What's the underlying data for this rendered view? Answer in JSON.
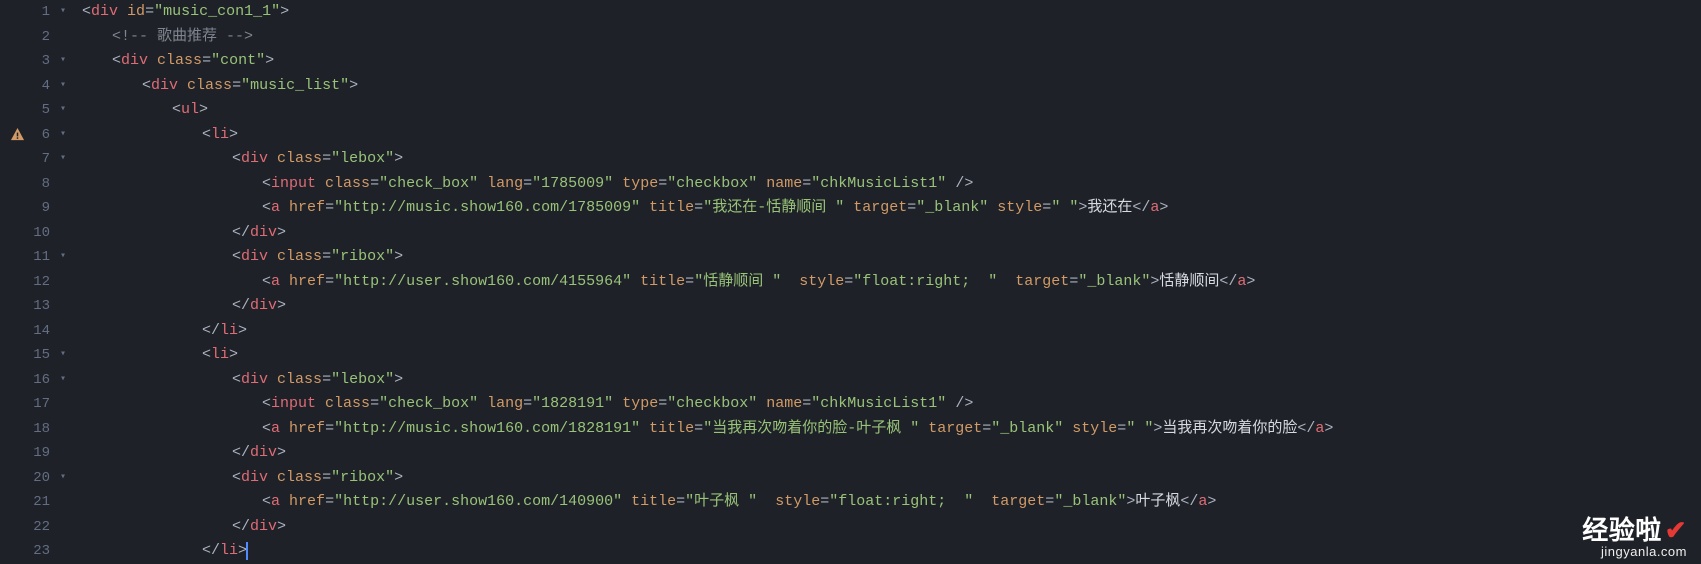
{
  "watermark": {
    "brand": "经验啦",
    "url": "jingyanla.com"
  },
  "gutter": [
    {
      "n": "1",
      "fold": true,
      "warn": false
    },
    {
      "n": "2",
      "fold": false,
      "warn": false
    },
    {
      "n": "3",
      "fold": true,
      "warn": false
    },
    {
      "n": "4",
      "fold": true,
      "warn": false
    },
    {
      "n": "5",
      "fold": true,
      "warn": false
    },
    {
      "n": "6",
      "fold": true,
      "warn": true
    },
    {
      "n": "7",
      "fold": true,
      "warn": false
    },
    {
      "n": "8",
      "fold": false,
      "warn": false
    },
    {
      "n": "9",
      "fold": false,
      "warn": false
    },
    {
      "n": "10",
      "fold": false,
      "warn": false
    },
    {
      "n": "11",
      "fold": true,
      "warn": false
    },
    {
      "n": "12",
      "fold": false,
      "warn": false
    },
    {
      "n": "13",
      "fold": false,
      "warn": false
    },
    {
      "n": "14",
      "fold": false,
      "warn": false
    },
    {
      "n": "15",
      "fold": true,
      "warn": false
    },
    {
      "n": "16",
      "fold": true,
      "warn": false
    },
    {
      "n": "17",
      "fold": false,
      "warn": false
    },
    {
      "n": "18",
      "fold": false,
      "warn": false
    },
    {
      "n": "19",
      "fold": false,
      "warn": false
    },
    {
      "n": "20",
      "fold": true,
      "warn": false
    },
    {
      "n": "21",
      "fold": false,
      "warn": false
    },
    {
      "n": "22",
      "fold": false,
      "warn": false
    },
    {
      "n": "23",
      "fold": false,
      "warn": false
    }
  ],
  "code": {
    "l1": {
      "open": "<",
      "tag": "div",
      "a_id": "id",
      "v_id": "\"music_con1_1\"",
      "close": ">"
    },
    "l2": {
      "open": "<!-- ",
      "text": "歌曲推荐",
      "close": " -->"
    },
    "l3": {
      "open": "<",
      "tag": "div",
      "a_cls": "class",
      "v_cls": "\"cont\"",
      "close": ">"
    },
    "l4": {
      "open": "<",
      "tag": "div",
      "a_cls": "class",
      "v_cls": "\"music_list\"",
      "close": ">"
    },
    "l5": {
      "open": "<",
      "tag": "ul",
      "close": ">"
    },
    "l6": {
      "open": "<",
      "tag": "li",
      "close": ">"
    },
    "l7": {
      "open": "<",
      "tag": "div",
      "a_cls": "class",
      "v_cls": "\"lebox\"",
      "close": ">"
    },
    "l8": {
      "open": "<",
      "tag": "input",
      "a_cls": "class",
      "v_cls": "\"check_box\"",
      "a_lang": "lang",
      "v_lang": "\"1785009\"",
      "a_type": "type",
      "v_type": "\"checkbox\"",
      "a_name": "name",
      "v_name": "\"chkMusicList1\"",
      "close": " />"
    },
    "l9": {
      "open": "<",
      "tag": "a",
      "a_href": "href",
      "v_href": "\"http://music.show160.com/1785009\"",
      "a_title": "title",
      "v_title": "\"我还在-恬静顺间 \"",
      "a_target": "target",
      "v_target": "\"_blank\"",
      "a_style": "style",
      "v_style": "\" \"",
      "mid": ">",
      "text": "我还在",
      "copen": "</",
      "ctag": "a",
      "cclose": ">"
    },
    "l10": {
      "open": "</",
      "tag": "div",
      "close": ">"
    },
    "l11": {
      "open": "<",
      "tag": "div",
      "a_cls": "class",
      "v_cls": "\"ribox\"",
      "close": ">"
    },
    "l12": {
      "open": "<",
      "tag": "a",
      "a_href": "href",
      "v_href": "\"http://user.show160.com/4155964\"",
      "a_title": "title",
      "v_title": "\"恬静顺间 \"",
      "a_style": "style",
      "v_style": "\"float:right;  \"",
      "a_target": "target",
      "v_target": "\"_blank\"",
      "mid": ">",
      "text": "恬静顺间",
      "copen": "</",
      "ctag": "a",
      "cclose": ">"
    },
    "l13": {
      "open": "</",
      "tag": "div",
      "close": ">"
    },
    "l14": {
      "open": "</",
      "tag": "li",
      "close": ">"
    },
    "l15": {
      "open": "<",
      "tag": "li",
      "close": ">"
    },
    "l16": {
      "open": "<",
      "tag": "div",
      "a_cls": "class",
      "v_cls": "\"lebox\"",
      "close": ">"
    },
    "l17": {
      "open": "<",
      "tag": "input",
      "a_cls": "class",
      "v_cls": "\"check_box\"",
      "a_lang": "lang",
      "v_lang": "\"1828191\"",
      "a_type": "type",
      "v_type": "\"checkbox\"",
      "a_name": "name",
      "v_name": "\"chkMusicList1\"",
      "close": " />"
    },
    "l18": {
      "open": "<",
      "tag": "a",
      "a_href": "href",
      "v_href": "\"http://music.show160.com/1828191\"",
      "a_title": "title",
      "v_title": "\"当我再次吻着你的脸-叶子枫 \"",
      "a_target": "target",
      "v_target": "\"_blank\"",
      "a_style": "style",
      "v_style": "\" \"",
      "mid": ">",
      "text": "当我再次吻着你的脸",
      "copen": "</",
      "ctag": "a",
      "cclose": ">"
    },
    "l19": {
      "open": "</",
      "tag": "div",
      "close": ">"
    },
    "l20": {
      "open": "<",
      "tag": "div",
      "a_cls": "class",
      "v_cls": "\"ribox\"",
      "close": ">"
    },
    "l21": {
      "open": "<",
      "tag": "a",
      "a_href": "href",
      "v_href": "\"http://user.show160.com/140900\"",
      "a_title": "title",
      "v_title": "\"叶子枫 \"",
      "a_style": "style",
      "v_style": "\"float:right;  \"",
      "a_target": "target",
      "v_target": "\"_blank\"",
      "mid": ">",
      "text": "叶子枫",
      "copen": "</",
      "ctag": "a",
      "cclose": ">"
    },
    "l22": {
      "open": "</",
      "tag": "div",
      "close": ">"
    },
    "l23": {
      "open": "</",
      "tag": "li",
      "close": ">"
    }
  }
}
